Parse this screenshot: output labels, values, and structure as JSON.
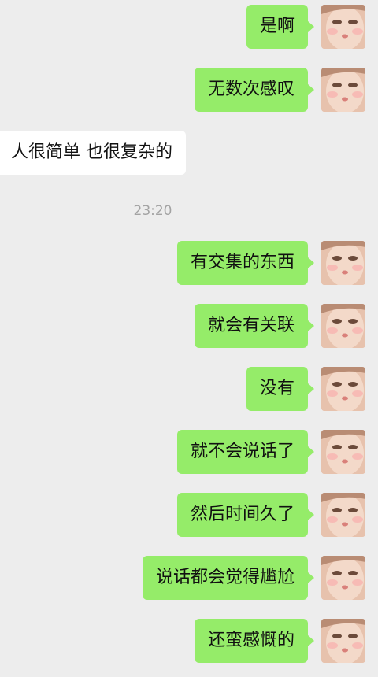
{
  "messages": [
    {
      "side": "mine",
      "text": "是啊"
    },
    {
      "side": "mine",
      "text": "无数次感叹"
    },
    {
      "side": "theirs",
      "text": "人很简单 也很复杂的"
    },
    {
      "side": "mine",
      "text": "有交集的东西"
    },
    {
      "side": "mine",
      "text": "就会有关联"
    },
    {
      "side": "mine",
      "text": "没有"
    },
    {
      "side": "mine",
      "text": "就不会说话了"
    },
    {
      "side": "mine",
      "text": "然后时间久了"
    },
    {
      "side": "mine",
      "text": "说话都会觉得尴尬"
    },
    {
      "side": "mine",
      "text": "还蛮感慨的"
    }
  ],
  "timestamp": "23:20",
  "avatar": {
    "icon": "selfie-avatar"
  },
  "colors": {
    "background": "#ededed",
    "mine_bubble": "#95ec69",
    "their_bubble": "#ffffff",
    "timestamp_text": "#a3a3a3"
  }
}
